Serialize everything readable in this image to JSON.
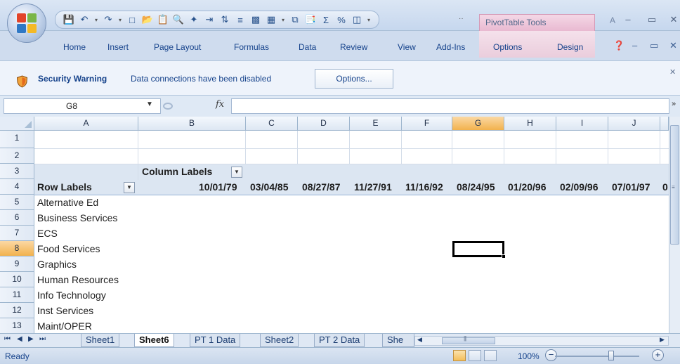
{
  "qat": {
    "more": "··"
  },
  "ribbon": {
    "tabs": [
      "Home",
      "Insert",
      "Page Layout",
      "Formulas",
      "Data",
      "Review",
      "View",
      "Add-Ins",
      "Options",
      "Design"
    ],
    "context_title": "PivotTable Tools",
    "title_fragment": "A"
  },
  "security": {
    "title": "Security Warning",
    "message": "Data connections have been disabled",
    "options_label": "Options..."
  },
  "formula_bar": {
    "name_box": "G8",
    "fx": "fx",
    "value": ""
  },
  "grid": {
    "columns": [
      "A",
      "B",
      "C",
      "D",
      "E",
      "F",
      "G",
      "H",
      "I",
      "J"
    ],
    "selected_column": "G",
    "rows": [
      "1",
      "2",
      "3",
      "4",
      "5",
      "6",
      "7",
      "8",
      "9",
      "10",
      "11",
      "12",
      "13"
    ],
    "selected_row": "8",
    "pivot": {
      "column_labels": "Column Labels",
      "row_labels": "Row Labels",
      "dates": [
        "10/01/79",
        "03/04/85",
        "08/27/87",
        "11/27/91",
        "11/16/92",
        "08/24/95",
        "01/20/96",
        "02/09/96",
        "07/01/97",
        "0"
      ],
      "row_items": [
        "Alternative Ed",
        "Business Services",
        "ECS",
        "Food Services",
        "Graphics",
        "Human Resources",
        "Info Technology",
        "Inst Services",
        "Maint/OPER"
      ]
    }
  },
  "sheets": {
    "tabs": [
      "Sheet1",
      "Sheet6",
      "PT 1 Data",
      "Sheet2",
      "PT 2 Data",
      "She"
    ],
    "active": "Sheet6"
  },
  "status": {
    "ready": "Ready",
    "zoom": "100%"
  }
}
